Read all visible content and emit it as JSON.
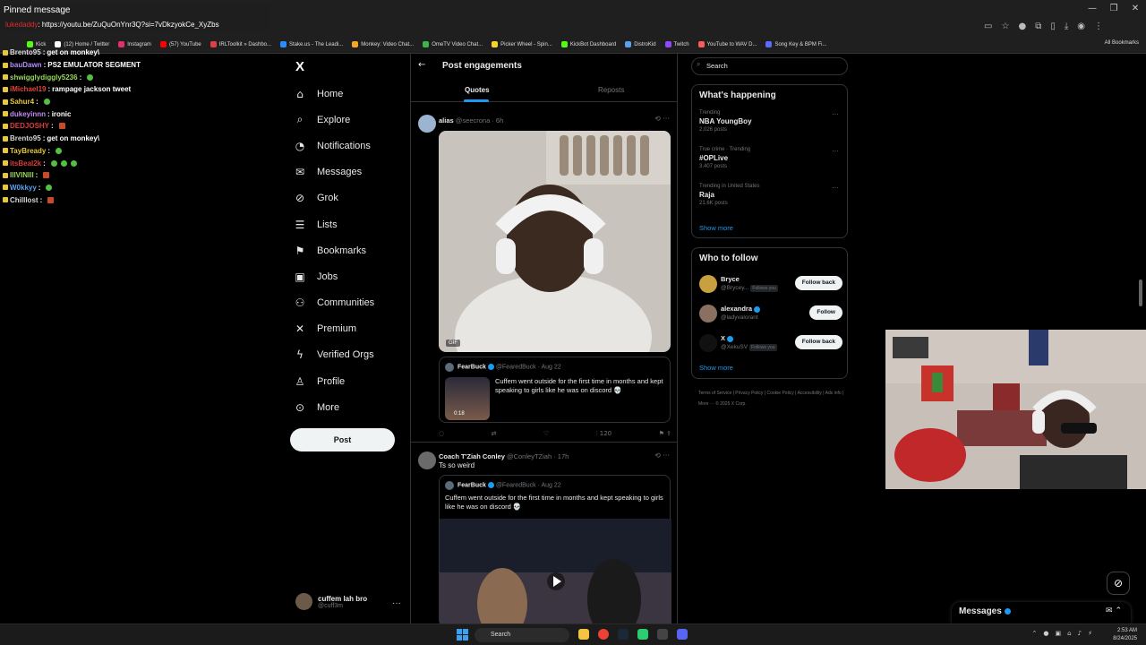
{
  "chat": {
    "pinned_title": "Pinned message",
    "pinned_user": "lukedaddy",
    "pinned_link": ": https://youtu.be/ZuQuOnYnr3Q?si=7vDkzyokCe_XyZbs",
    "lines": [
      {
        "user": "Brento95",
        "color": "#d6d6d6",
        "msg": "get on monkey\\",
        "emote": ""
      },
      {
        "user": "bauDawn",
        "color": "#b58cff",
        "msg": "PS2 EMULATOR SEGMENT",
        "emote": ""
      },
      {
        "user": "shwigglydiggly5236",
        "color": "#9ad65a",
        "msg": "",
        "emote": "green"
      },
      {
        "user": "iMichael19",
        "color": "#e0453a",
        "msg": "rampage jackson tweet",
        "emote": ""
      },
      {
        "user": "Sahur4",
        "color": "#e6c83a",
        "msg": "",
        "emote": "green"
      },
      {
        "user": "dukeyinnn",
        "color": "#c08cf0",
        "msg": "ironic",
        "emote": ""
      },
      {
        "user": "DEDJOSHY",
        "color": "#e03a3a",
        "msg": "",
        "emote": "red"
      },
      {
        "user": "Brento95",
        "color": "#d6d6d6",
        "msg": "get on monkey\\",
        "emote": ""
      },
      {
        "user": "TayBready",
        "color": "#e6c83a",
        "msg": "",
        "emote": "green"
      },
      {
        "user": "itsBeal2k",
        "color": "#e03a3a",
        "msg": "",
        "emote": "green3"
      },
      {
        "user": "IllVINIll",
        "color": "#9ad65a",
        "msg": "",
        "emote": "red"
      },
      {
        "user": "W0kkyy",
        "color": "#5aa0f0",
        "msg": "",
        "emote": "green"
      },
      {
        "user": "Chilllost",
        "color": "#d6d6d6",
        "msg": "",
        "emote": "red"
      }
    ]
  },
  "bookmarks": [
    {
      "label": "Kick",
      "color": "#53fc18"
    },
    {
      "label": "(12) Home / Twitter",
      "color": "#ffffff"
    },
    {
      "label": "Instagram",
      "color": "#e1306c"
    },
    {
      "label": "(57) YouTube",
      "color": "#ff0000"
    },
    {
      "label": "IRLToolkit » Dashbo...",
      "color": "#e04040"
    },
    {
      "label": "Stake.us - The Leadi...",
      "color": "#2a8cff"
    },
    {
      "label": "Monkey: Video Chat...",
      "color": "#f5a623"
    },
    {
      "label": "OmeTV Video Chat...",
      "color": "#3ab54a"
    },
    {
      "label": "Picker Wheel - Spin...",
      "color": "#f5d623"
    },
    {
      "label": "KickBot Dashboard",
      "color": "#53fc18"
    },
    {
      "label": "DistroKid",
      "color": "#5aa0f0"
    },
    {
      "label": "Twitch",
      "color": "#9146ff"
    },
    {
      "label": "YouTube to WAV D...",
      "color": "#ff5a5a"
    },
    {
      "label": "Song Key & BPM Fi...",
      "color": "#5a6cff"
    }
  ],
  "bookmarks_all": "All Bookmarks",
  "nav": {
    "logo": "X",
    "items": [
      {
        "label": "Home",
        "icon": "home-icon",
        "glyph": "⌂"
      },
      {
        "label": "Explore",
        "icon": "search-icon",
        "glyph": "⌕"
      },
      {
        "label": "Notifications",
        "icon": "bell-icon",
        "glyph": "◔"
      },
      {
        "label": "Messages",
        "icon": "envelope-icon",
        "glyph": "✉"
      },
      {
        "label": "Grok",
        "icon": "grok-icon",
        "glyph": "⊘"
      },
      {
        "label": "Lists",
        "icon": "list-icon",
        "glyph": "☰"
      },
      {
        "label": "Bookmarks",
        "icon": "bookmark-icon",
        "glyph": "⚑"
      },
      {
        "label": "Jobs",
        "icon": "briefcase-icon",
        "glyph": "▣"
      },
      {
        "label": "Communities",
        "icon": "people-icon",
        "glyph": "⚇"
      },
      {
        "label": "Premium",
        "icon": "x-premium-icon",
        "glyph": "✕"
      },
      {
        "label": "Verified Orgs",
        "icon": "lightning-icon",
        "glyph": "ϟ"
      },
      {
        "label": "Profile",
        "icon": "person-icon",
        "glyph": "♙"
      },
      {
        "label": "More",
        "icon": "more-circle-icon",
        "glyph": "⊙"
      }
    ],
    "post_label": "Post",
    "account_name": "cuffem lah bro",
    "account_handle": "@cuff3m",
    "account_more": "···"
  },
  "main": {
    "title": "Post engagements",
    "tabs": [
      "Quotes",
      "Reposts"
    ],
    "tweet1": {
      "name": "alias",
      "handle": "@seecrona · 6h",
      "gif_label": "GIF",
      "quote_name": "FearBuck",
      "quote_handle": "@FearedBuck · Aug 22",
      "quote_text": "Cuffem went outside for the first time in months and kept speaking to girls like he was on discord 💀",
      "quote_duration": "0:18",
      "views": "120"
    },
    "tweet2": {
      "name": "Coach T'Ziah Conley",
      "handle": "@ConleyTZiah · 17h",
      "text": "Ts so weird",
      "quote_name": "FearBuck",
      "quote_handle": "@FearedBuck · Aug 22",
      "quote_text": "Cuffem went outside for the first time in months and kept speaking to girls like he was on discord 💀"
    }
  },
  "right": {
    "search_placeholder": "Search",
    "happening_title": "What's happening",
    "trends": [
      {
        "category": "Trending",
        "name": "NBA YoungBoy",
        "count": "2,026 posts"
      },
      {
        "category": "True crime · Trending",
        "name": "#OPLive",
        "count": "3,407 posts"
      },
      {
        "category": "Trending in United States",
        "name": "Raja",
        "count": "21.6K posts"
      }
    ],
    "show_more": "Show more",
    "wtf_title": "Who to follow",
    "follow": [
      {
        "name": "Bryce",
        "handle": "@Brycey...",
        "follows_you": "Follows you",
        "button": "Follow back"
      },
      {
        "name": "alexandra",
        "handle": "@ladyvalorant",
        "follows_you": "",
        "button": "Follow"
      },
      {
        "name": "X",
        "handle": "@XekuSV",
        "follows_you": "Follows you",
        "button": "Follow back"
      }
    ],
    "footer": "Terms of Service | Privacy Policy | Cookie Policy | Accessibility | Ads info | More ··· © 2025 X Corp."
  },
  "messages_drawer": "Messages",
  "taskbar": {
    "search": "Search",
    "time": "2:53 AM",
    "date": "8/24/2025"
  }
}
